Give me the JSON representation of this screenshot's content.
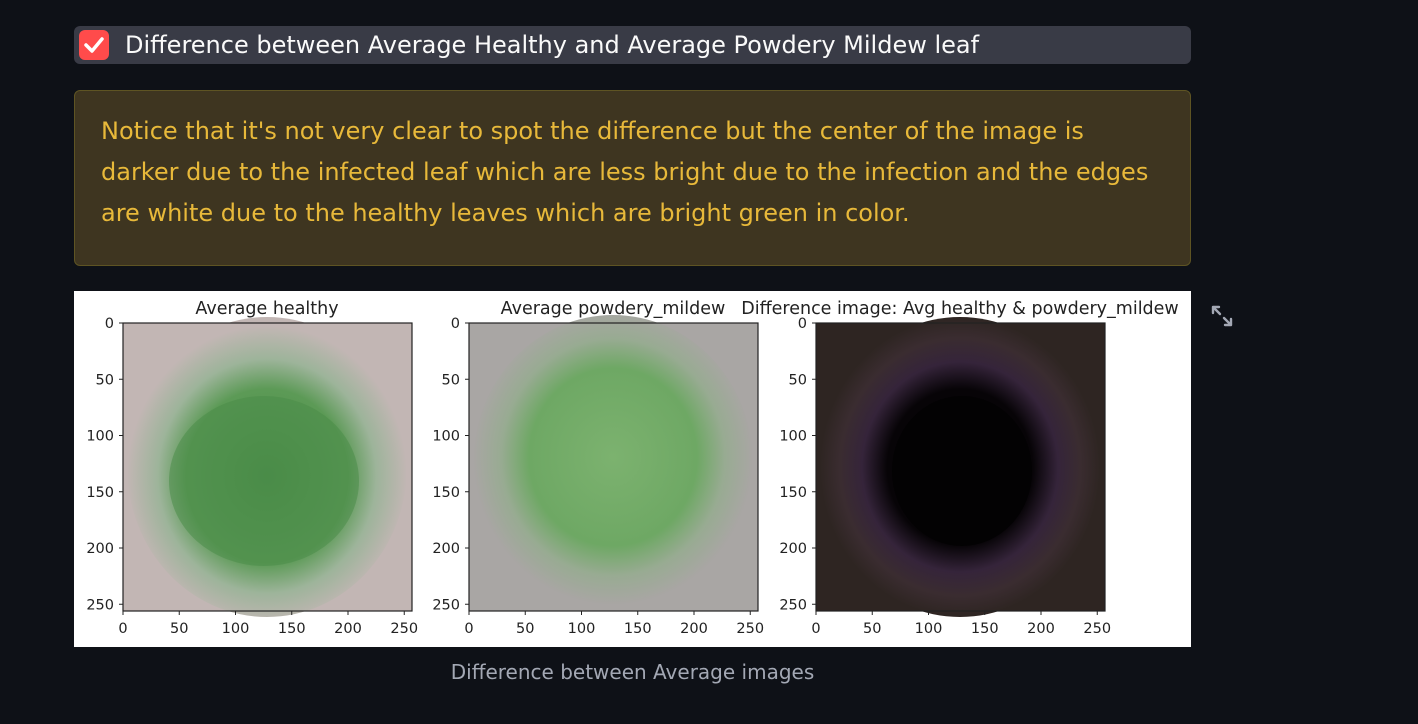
{
  "checkbox": {
    "checked": true,
    "label": "Difference between Average Healthy and Average Powdery Mildew leaf"
  },
  "callout": {
    "text": "Notice that it's not very clear to spot the difference but the center of the image is darker due to the infected leaf which are less bright due to the infection and the edges are white due to the healthy leaves which are bright green in color."
  },
  "figure": {
    "panels": [
      {
        "title": "Average healthy"
      },
      {
        "title": "Average powdery_mildew"
      },
      {
        "title": "Difference image: Avg healthy & powdery_mildew"
      }
    ],
    "ticks": [
      "0",
      "50",
      "100",
      "150",
      "200",
      "250"
    ],
    "colors": {
      "healthy_background": "#c2b6b4",
      "healthy_leaf": "#4a8c48",
      "mildew_background": "#a9a6a4",
      "mildew_leaf": "#6ea864",
      "difference_background": "#2e2522",
      "difference_leaf": "#050305",
      "difference_tint": "#503255"
    },
    "caption": "Difference between Average images"
  },
  "fullscreen_icon": "expand-icon",
  "accent_color": "#ff4b4b"
}
